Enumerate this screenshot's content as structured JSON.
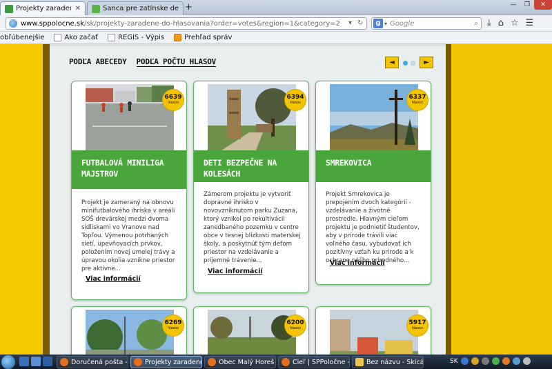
{
  "browser": {
    "tabs": [
      {
        "label": "Projekty zaradené do hlaso...",
        "active": true
      },
      {
        "label": "Šanca pre zatínske deti | Pr...",
        "active": false
      }
    ],
    "newtab_label": "+",
    "url_host": "www.sppolocne.sk",
    "url_path": "/sk/projekty-zaradene-do-hlasovania?order=votes&region=1&category=2",
    "search_engine": "g",
    "search_placeholder": "Google",
    "bookmarks": [
      "obľúbenejšie",
      "Ako začať",
      "REGIS - Výpis",
      "Prehľad správ"
    ]
  },
  "page": {
    "sort_tabs": [
      {
        "label": "PODĽA ABECEDY",
        "active": false
      },
      {
        "label": "PODĽA POČTU HLASOV",
        "active": true
      }
    ],
    "prev_label": "◄",
    "next_label": "►",
    "vote_unit": "hlasov",
    "more_label": "Viac informácií",
    "cards": [
      {
        "votes": "6639",
        "title": "FUTBALOVÁ MINILIGA MAJSTROV",
        "desc": "Projekt je zameraný na obnovu minifutbalového ihriska v areáli SOŠ drevárskej medzi dvoma sídliskami vo Vranove nad Topľou. Výmenou potrhaných sietí, upevňovacích prvkov, položením novej umelej trávy a úpravou okolia vznikne priestor pre aktívne..."
      },
      {
        "votes": "6394",
        "title": "DETI BEZPEČNE NA KOLESÁCH",
        "desc": "Zámerom projektu je vytvoriť dopravné ihrisko v novovzniknutom parku Zuzana, ktorý vznikol po rekultivácii zanedbaného pozemku v centre obce v tesnej blízkosti materskej školy, a poskytnúť tým deťom priestor na vzdelávanie a príjemné trávenie..."
      },
      {
        "votes": "6337",
        "title": "SMREKOVICA",
        "desc": "Projekt Smrekovica je prepojením dvoch kategórií - vzdelávanie a životné prostredie. Hlavným cieľom projektu je podnietiť študentov, aby v prírode trávili viac voľného času, vybudovať ich pozitívny vzťah ku prírode a k ochrane nášho prírodného..."
      },
      {
        "votes": "6269"
      },
      {
        "votes": "6200"
      },
      {
        "votes": "5917"
      }
    ]
  },
  "taskbar": {
    "items": [
      {
        "label": "Doručená pošta - an...",
        "active": false
      },
      {
        "label": "Projekty zaradené d...",
        "active": true
      },
      {
        "label": "Obec Malý Horeš | o...",
        "active": false
      },
      {
        "label": "Cieľ | SPPoločne - ...",
        "active": false
      },
      {
        "label": "Bez názvu - Skicár",
        "active": false
      }
    ],
    "lang": "SK"
  },
  "colors": {
    "accent_yellow": "#f5c400",
    "accent_green": "#49a63a",
    "content_bg": "#e9eeee"
  }
}
